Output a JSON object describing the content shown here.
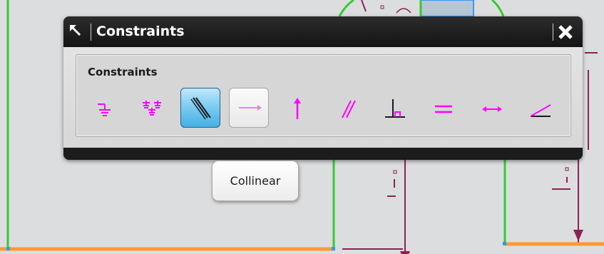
{
  "dialog": {
    "title": "Constraints",
    "group_label": "Constraints",
    "tools": [
      {
        "name": "fixed",
        "icon": "fixed-icon",
        "state": "normal"
      },
      {
        "name": "fully-fixed",
        "icon": "fully-fixed-icon",
        "state": "normal"
      },
      {
        "name": "collinear",
        "icon": "collinear-icon",
        "state": "active"
      },
      {
        "name": "horizontal",
        "icon": "horizontal-icon",
        "state": "disabled"
      },
      {
        "name": "vertical",
        "icon": "vertical-icon",
        "state": "normal"
      },
      {
        "name": "parallel",
        "icon": "parallel-icon",
        "state": "normal"
      },
      {
        "name": "perpendicular",
        "icon": "perpendicular-icon",
        "state": "normal"
      },
      {
        "name": "equal-length",
        "icon": "equal-length-icon",
        "state": "normal"
      },
      {
        "name": "constant-length",
        "icon": "constant-length-icon",
        "state": "normal"
      },
      {
        "name": "constant-angle",
        "icon": "constant-angle-icon",
        "state": "normal"
      }
    ]
  },
  "tooltip": {
    "text": "Collinear"
  },
  "colors": {
    "constraint_magenta": "#ff00ff",
    "curve_green": "#33cc33",
    "curve_orange": "#ff9933",
    "dimension_maroon": "#8b2252",
    "active_blue": "#45afe6"
  }
}
